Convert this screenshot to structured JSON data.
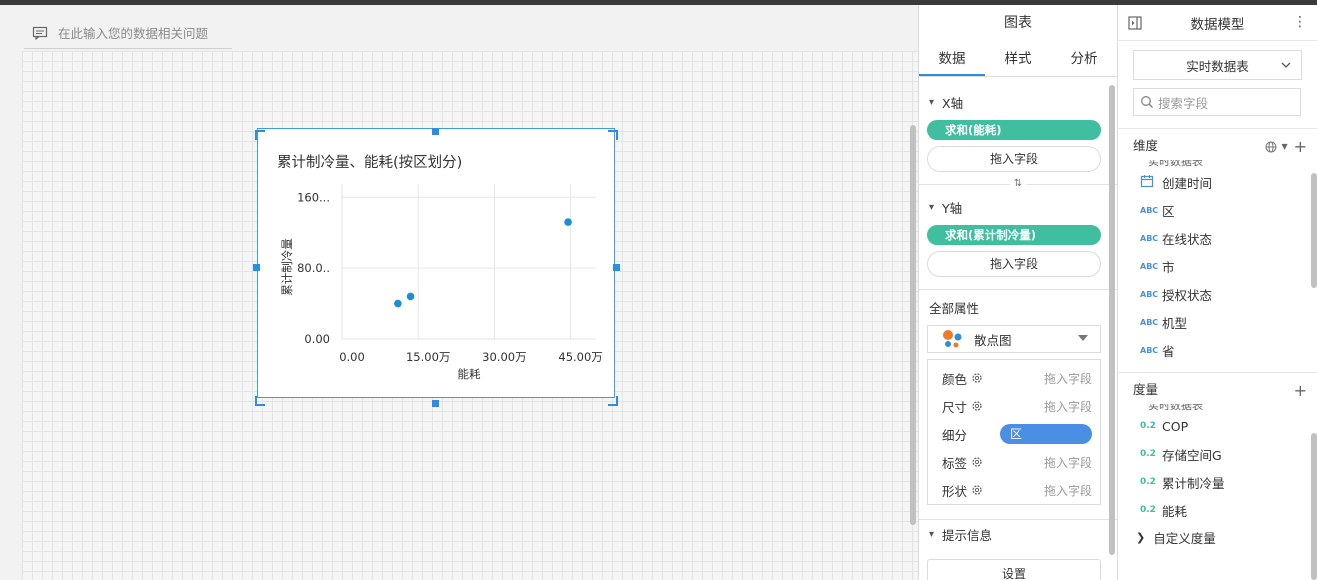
{
  "canvas": {
    "question_placeholder": "在此输入您的数据相关问题"
  },
  "chart_data": {
    "type": "scatter",
    "title": "累计制冷量、能耗(按区划分)",
    "xlabel": "能耗",
    "ylabel": "累计制冷量",
    "x_ticks": [
      "0.00",
      "15.00万",
      "30.00万",
      "45.00万"
    ],
    "y_ticks": [
      "0.00",
      "80.0..",
      "160..."
    ],
    "xlim": [
      0,
      500000
    ],
    "ylim": [
      0,
      175
    ],
    "points": [
      {
        "x": 110000,
        "y": 40
      },
      {
        "x": 135000,
        "y": 48
      },
      {
        "x": 445000,
        "y": 132
      }
    ],
    "point_color": "#1a8fd6"
  },
  "mid_panel": {
    "header": "图表",
    "tabs": [
      "数据",
      "样式",
      "分析"
    ],
    "x_axis": {
      "label": "X轴",
      "field": "求和(能耗)",
      "drop": "拖入字段"
    },
    "y_axis": {
      "label": "Y轴",
      "field": "求和(累计制冷量)",
      "drop": "拖入字段"
    },
    "swap_icon": "⇅",
    "all_props": "全部属性",
    "chart_type": "散点图",
    "props": {
      "color": {
        "name": "颜色",
        "hint": "拖入字段"
      },
      "size": {
        "name": "尺寸",
        "hint": "拖入字段"
      },
      "detail": {
        "name": "细分",
        "value": "区"
      },
      "label": {
        "name": "标签",
        "hint": "拖入字段"
      },
      "shape": {
        "name": "形状",
        "hint": "拖入字段"
      }
    },
    "tooltip": "提示信息",
    "settings": "设置"
  },
  "right_panel": {
    "header": "数据模型",
    "dataset": "实时数据表",
    "search_placeholder": "搜索字段",
    "dimensions_title": "维度",
    "dimensions_cut": "实时数据表",
    "dimensions": [
      {
        "type": "date",
        "name": "创建时间"
      },
      {
        "type": "ABC",
        "name": "区"
      },
      {
        "type": "ABC",
        "name": "在线状态"
      },
      {
        "type": "ABC",
        "name": "市"
      },
      {
        "type": "ABC",
        "name": "授权状态"
      },
      {
        "type": "ABC",
        "name": "机型"
      },
      {
        "type": "ABC",
        "name": "省"
      }
    ],
    "measures_title": "度量",
    "measures_cut": "实时数据表",
    "measures": [
      {
        "type": "0.2",
        "name": "COP"
      },
      {
        "type": "0.2",
        "name": "存储空间G"
      },
      {
        "type": "0.2",
        "name": "累计制冷量"
      },
      {
        "type": "0.2",
        "name": "能耗"
      }
    ],
    "custom_measures": "自定义度量"
  }
}
